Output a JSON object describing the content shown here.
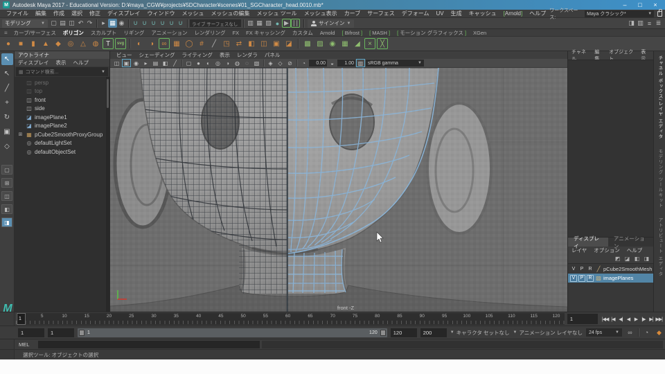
{
  "colors": {
    "accent_blue": "#5285a6",
    "shelf_orange": "#d08a45",
    "plugin_green": "#6cc25a",
    "wireframe_blue": "#8ab4d8",
    "titlebar_blue": "#3e90c8",
    "autokey_orange": "#d98a3a"
  },
  "window": {
    "app_badge": "M",
    "title": "Autodesk Maya 2017 - Educational Version: D:¥maya_CGW¥projects¥5DCharacter¥scenes¥01_SGCharacter_head.0010.mb*",
    "minimize": "–",
    "maximize": "□",
    "close": "×"
  },
  "menu_bar": {
    "items": [
      {
        "id": "file",
        "label": "ファイル"
      },
      {
        "id": "edit",
        "label": "編集"
      },
      {
        "id": "create",
        "label": "作成"
      },
      {
        "id": "select",
        "label": "選択"
      },
      {
        "id": "modify",
        "label": "修正"
      },
      {
        "id": "display",
        "label": "ディスプレイ"
      },
      {
        "id": "windows",
        "label": "ウィンドウ"
      },
      {
        "id": "mesh",
        "label": "メッシュ"
      },
      {
        "id": "edit-mesh",
        "label": "メッシュの編集"
      },
      {
        "id": "mesh-tools",
        "label": "メッシュ ツール"
      },
      {
        "id": "mesh-display",
        "label": "メッシュ表示"
      },
      {
        "id": "curves",
        "label": "カーブ"
      },
      {
        "id": "surfaces",
        "label": "サーフェス"
      },
      {
        "id": "deform",
        "label": "デフォーム"
      },
      {
        "id": "uv",
        "label": "UV"
      },
      {
        "id": "generate",
        "label": "生成"
      },
      {
        "id": "cache",
        "label": "キャッシュ"
      },
      {
        "id": "arnold",
        "label": "Arnold",
        "accent": true
      },
      {
        "id": "help",
        "label": "ヘルプ"
      }
    ],
    "workspace_label": "ワークスペース:",
    "workspace_value": "Maya クラシック*"
  },
  "status_line": {
    "mode_selector": "モデリング",
    "live_surface": "ライブ サーフェスなし",
    "sign_in_label": "サインイン",
    "groups": [
      {
        "icons": [
          {
            "n": "new-scene-icon",
            "g": "▢"
          },
          {
            "n": "open-scene-icon",
            "g": "▤"
          },
          {
            "n": "save-scene-icon",
            "g": "◫"
          },
          {
            "n": "undo-icon",
            "g": "↶"
          },
          {
            "n": "redo-icon",
            "g": "↷"
          }
        ]
      },
      {
        "icons": [
          {
            "n": "select-hierarchy-icon",
            "g": "▸"
          },
          {
            "n": "select-object-icon",
            "g": "▦",
            "active": true
          },
          {
            "n": "select-component-icon",
            "g": "◉"
          }
        ]
      },
      {
        "icons": [
          {
            "n": "snap-to-grid-icon",
            "g": "∪",
            "teal": true
          },
          {
            "n": "snap-to-curve-icon",
            "g": "∪",
            "teal": true
          },
          {
            "n": "snap-to-point-icon",
            "g": "∪",
            "teal": true
          },
          {
            "n": "snap-to-plane-icon",
            "g": "∪",
            "teal": true
          },
          {
            "n": "snap-to-view-plane-icon",
            "g": "∪",
            "teal": true
          },
          {
            "n": "make-live-icon",
            "g": "∪",
            "teal": true
          }
        ]
      },
      {
        "field": "live_surface"
      },
      {
        "icons": [
          {
            "n": "construction-history-icon",
            "g": "▥"
          },
          {
            "n": "render-current-frame-icon",
            "g": "▦"
          },
          {
            "n": "ipr-render-icon",
            "g": "▧"
          },
          {
            "n": "render-settings-icon",
            "g": "●",
            "teal": true
          },
          {
            "n": "launch-render-view-icon",
            "g": "▶",
            "framed": true
          },
          {
            "n": "pause-viewport-icon",
            "g": "∣∣",
            "framed": true
          }
        ]
      }
    ],
    "right_icons": [
      {
        "n": "raise-main-window-icon",
        "g": "◨"
      },
      {
        "n": "show-hotbox-icon",
        "g": "▥"
      },
      {
        "n": "toggle-attribute-editor-icon",
        "g": "≡"
      },
      {
        "n": "toggle-channel-box-icon",
        "g": "≣"
      }
    ]
  },
  "shelf": {
    "tabs": [
      {
        "id": "curves-surfaces",
        "label": "カーブ/サーフェス"
      },
      {
        "id": "polygons",
        "label": "ポリゴン",
        "active": true
      },
      {
        "id": "sculpting",
        "label": "スカルプト"
      },
      {
        "id": "rigging",
        "label": "リギング"
      },
      {
        "id": "animation",
        "label": "アニメーション"
      },
      {
        "id": "rendering",
        "label": "レンダリング"
      },
      {
        "id": "fx",
        "label": "FX"
      },
      {
        "id": "fx-caching",
        "label": "FX キャッシング"
      },
      {
        "id": "custom",
        "label": "カスタム"
      },
      {
        "id": "arnold",
        "label": "Arnold"
      },
      {
        "id": "bifrost",
        "label": "Bifrost",
        "bracketed": true
      },
      {
        "id": "mash",
        "label": "MASH",
        "bracketed": true
      },
      {
        "id": "motion-graphics",
        "label": "モーション グラフィックス",
        "bracketed": true
      },
      {
        "id": "xgen",
        "label": "XGen"
      }
    ],
    "icons": [
      {
        "n": "poly-sphere-icon",
        "g": "●",
        "c": "orange"
      },
      {
        "n": "poly-cube-icon",
        "g": "■",
        "c": "orange"
      },
      {
        "n": "poly-cylinder-icon",
        "g": "▮",
        "c": "orange"
      },
      {
        "n": "poly-cone-icon",
        "g": "▲",
        "c": "orange"
      },
      {
        "n": "poly-plane-icon",
        "g": "◆",
        "c": "orange"
      },
      {
        "n": "poly-torus-icon",
        "g": "◎",
        "c": "orange"
      },
      {
        "n": "poly-pyramid-icon",
        "g": "△",
        "c": "orange"
      },
      {
        "n": "poly-pipe-icon",
        "g": "◍",
        "c": "orange"
      },
      {
        "n": "poly-text-icon",
        "g": "T",
        "c": "white",
        "framed": true
      },
      {
        "n": "poly-svg-icon",
        "g": "svg",
        "c": "green",
        "framed": true,
        "small": true
      },
      {
        "n": "sep"
      },
      {
        "n": "smooth-icon",
        "g": "◐",
        "c": "orange"
      },
      {
        "n": "smooth-preview-icon",
        "g": "◑",
        "c": "orange"
      },
      {
        "n": "poly-type-icon",
        "g": "∞",
        "c": "orange",
        "framed": true
      },
      {
        "n": "subdiv-cube-icon",
        "g": "▦",
        "c": "orange"
      },
      {
        "n": "sculpt-sphere-icon",
        "g": "◯",
        "c": "orange"
      },
      {
        "n": "lattice-icon",
        "g": "#",
        "c": "orange"
      },
      {
        "n": "knife-tool-icon",
        "g": "╱",
        "c": "gray"
      },
      {
        "n": "extrude-icon",
        "g": "◳",
        "c": "orange"
      },
      {
        "n": "mirror-icon",
        "g": "⇄",
        "c": "orange"
      },
      {
        "n": "boolean-icon",
        "g": "◧",
        "c": "orange"
      },
      {
        "n": "bridge-icon",
        "g": "◫",
        "c": "orange"
      },
      {
        "n": "quad-draw-ref-icon",
        "g": "▣",
        "c": "orange"
      },
      {
        "n": "bevel-icon",
        "g": "◪",
        "c": "orange"
      },
      {
        "n": "sep"
      },
      {
        "n": "combine-icon",
        "g": "▩",
        "c": "green"
      },
      {
        "n": "separate-icon",
        "g": "▨",
        "c": "green"
      },
      {
        "n": "smooth-mesh-icon",
        "g": "◉",
        "c": "green"
      },
      {
        "n": "add-divisions-icon",
        "g": "▦",
        "c": "green"
      },
      {
        "n": "extract-icon",
        "g": "◢",
        "c": "green"
      },
      {
        "n": "multi-cut-icon",
        "g": "×",
        "c": "green",
        "framedg": true
      },
      {
        "n": "target-weld-icon",
        "g": "╳",
        "c": "green",
        "framedg": true
      }
    ]
  },
  "toolbox": {
    "tools": [
      {
        "n": "select-tool",
        "g": "↖",
        "active": true
      },
      {
        "n": "lasso-select-tool",
        "g": "↖"
      },
      {
        "n": "paint-select-tool",
        "g": "╱"
      },
      {
        "n": "move-tool",
        "g": "+"
      },
      {
        "n": "rotate-tool",
        "g": "↻"
      },
      {
        "n": "scale-tool",
        "g": "▣"
      },
      {
        "n": "last-used-tool",
        "g": "◇"
      }
    ],
    "layouts": [
      {
        "n": "layout-single-pane",
        "g": "▢"
      },
      {
        "n": "layout-four-pane",
        "g": "⊞"
      },
      {
        "n": "layout-persp-outliner",
        "g": "◫"
      },
      {
        "n": "layout-two-pane",
        "g": "◧"
      },
      {
        "n": "layout-outliner-persp",
        "g": "◨",
        "active": true
      }
    ],
    "logo": "M"
  },
  "outliner": {
    "title": "アウトライナ",
    "menus": [
      {
        "id": "display",
        "label": "ディスプレイ"
      },
      {
        "id": "show",
        "label": "表示"
      },
      {
        "id": "help",
        "label": "ヘルプ"
      }
    ],
    "search_placeholder": "コマンド検索...",
    "items": [
      {
        "label": "persp",
        "type": "camera",
        "dim": true
      },
      {
        "label": "top",
        "type": "camera",
        "dim": true
      },
      {
        "label": "front",
        "type": "camera"
      },
      {
        "label": "side",
        "type": "camera"
      },
      {
        "label": "imagePlane1",
        "type": "image-plane"
      },
      {
        "label": "imagePlane2",
        "type": "image-plane"
      },
      {
        "label": "pCube2SmoothProxyGroup",
        "type": "group",
        "expandable": true
      },
      {
        "label": "defaultLightSet",
        "type": "set"
      },
      {
        "label": "defaultObjectSet",
        "type": "set"
      }
    ]
  },
  "viewport": {
    "menus": [
      {
        "id": "view",
        "label": "ビュー"
      },
      {
        "id": "shading",
        "label": "シェーディング"
      },
      {
        "id": "lighting",
        "label": "ライティング"
      },
      {
        "id": "show",
        "label": "表示"
      },
      {
        "id": "renderer",
        "label": "レンダラ"
      },
      {
        "id": "panels",
        "label": "パネル"
      }
    ],
    "toolbar_icons": [
      {
        "n": "camera-select-icon",
        "g": "◫"
      },
      {
        "n": "camera-lock-icon",
        "g": "▣",
        "framed": true
      },
      {
        "n": "camera-attributes-icon",
        "g": "◉"
      },
      {
        "n": "bookmark-icon",
        "g": "▸"
      },
      {
        "n": "image-plane-icon",
        "g": "▤"
      },
      {
        "n": "2d-pan-zoom-icon",
        "g": "◧"
      },
      {
        "n": "grease-pencil-icon",
        "g": "╱"
      },
      {
        "n": "sep"
      },
      {
        "n": "wireframe-icon",
        "g": "▢"
      },
      {
        "n": "smooth-shade-icon",
        "g": "●"
      },
      {
        "n": "textured-icon",
        "g": "◐"
      },
      {
        "n": "use-all-lights-icon",
        "g": "◎"
      },
      {
        "n": "shadows-icon",
        "g": "◑"
      },
      {
        "n": "screen-space-ao-icon",
        "g": "◍"
      },
      {
        "n": "motion-blur-icon",
        "g": "◌"
      },
      {
        "n": "multisample-aa-icon",
        "g": "▧"
      },
      {
        "n": "sep"
      },
      {
        "n": "isolate-select-icon",
        "g": "◈"
      },
      {
        "n": "xray-icon",
        "g": "◇"
      },
      {
        "n": "xray-joints-icon",
        "g": "⊘"
      },
      {
        "n": "sep"
      },
      {
        "n": "exposure-icon",
        "g": "◔"
      }
    ],
    "exposure": "0.00",
    "gamma_icon": "◒",
    "gamma": "1.00",
    "color_management_icon": "▥",
    "color_transform": "sRGB gamma",
    "camera_label": "front -Z"
  },
  "channel_box": {
    "menus": [
      {
        "id": "channels",
        "label": "チャネル"
      },
      {
        "id": "edit",
        "label": "編集"
      },
      {
        "id": "object",
        "label": "オブジェクト"
      },
      {
        "id": "show",
        "label": "表示"
      }
    ]
  },
  "sidebar_tabs": [
    {
      "id": "channel-box-layer-editor",
      "label": "チャネル ボックス/レイヤ エディタ",
      "active": true
    },
    {
      "id": "modeling-toolkit",
      "label": "モデリング ツールキット"
    },
    {
      "id": "attribute-editor",
      "label": "アトリビュート エディタ"
    }
  ],
  "layer_editor": {
    "tabs": [
      {
        "id": "display",
        "label": "ディスプレイ",
        "active": true
      },
      {
        "id": "anim",
        "label": "アニメーション"
      }
    ],
    "menus": [
      {
        "id": "layers",
        "label": "レイヤ"
      },
      {
        "id": "options",
        "label": "オプション"
      },
      {
        "id": "help",
        "label": "ヘルプ"
      }
    ],
    "toolbar_icons": [
      {
        "n": "move-layer-up-icon",
        "g": "◩"
      },
      {
        "n": "move-layer-down-icon",
        "g": "◪"
      },
      {
        "n": "new-empty-layer-icon",
        "g": "◧"
      },
      {
        "n": "new-layer-from-selected-icon",
        "g": "◨"
      }
    ],
    "columns": [
      "V",
      "P",
      "R"
    ],
    "layers": [
      {
        "name": "pCube2SmoothMesh",
        "type_glyph": "╱",
        "selected": false
      },
      {
        "name": "imagePlanes",
        "type_glyph": "▨",
        "selected": true
      }
    ]
  },
  "time_slider": {
    "tick_labels": [
      5,
      10,
      15,
      20,
      25,
      30,
      35,
      40,
      45,
      50,
      55,
      60,
      65,
      70,
      75,
      80,
      85,
      90,
      95,
      100,
      105,
      110,
      115,
      120
    ],
    "range_min": 1,
    "range_max": 120,
    "playhead_frame": "1",
    "current_frame": "1",
    "playback": [
      {
        "n": "go-to-start-button",
        "g": "|◀◀"
      },
      {
        "n": "step-back-frame-button",
        "g": "|◀"
      },
      {
        "n": "step-back-key-button",
        "g": "◀|"
      },
      {
        "n": "play-backwards-button",
        "g": "◀"
      },
      {
        "n": "play-forwards-button",
        "g": "▶"
      },
      {
        "n": "step-forward-key-button",
        "g": "|▶"
      },
      {
        "n": "step-forward-frame-button",
        "g": "▶|"
      },
      {
        "n": "go-to-end-button",
        "g": "▶▶|"
      }
    ]
  },
  "range_slider": {
    "animation_start": "1",
    "playback_start": "1",
    "bar_start": "1",
    "bar_end": "120",
    "playback_end": "120",
    "animation_end": "200",
    "character_set": "キャラクタ セットなし",
    "anim_layer": "アニメーション レイヤなし",
    "fps": "24 fps",
    "loop_icon": "∞",
    "anim_pref_icon": "◔",
    "auto_key_icon": "◆"
  },
  "command_line": {
    "label": "MEL"
  },
  "help_line": {
    "text": "選択ツール: オブジェクトの選択"
  }
}
